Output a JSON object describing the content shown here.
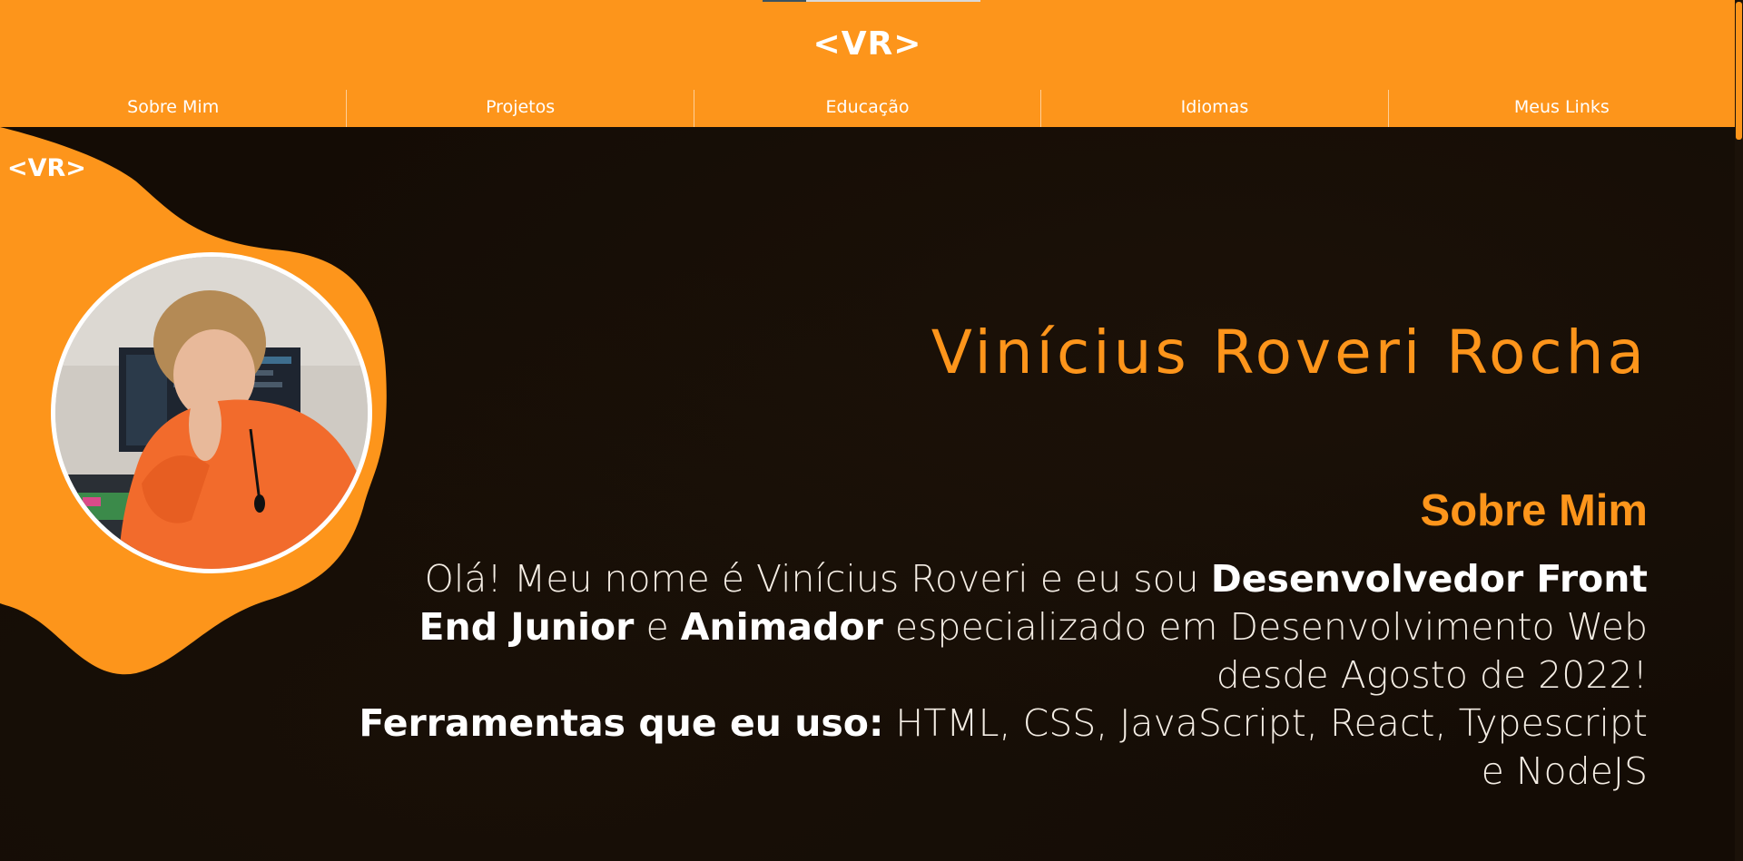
{
  "header": {
    "logo": "<VR>",
    "nav": [
      "Sobre Mim",
      "Projetos",
      "Educação",
      "Idiomas",
      "Meus Links"
    ]
  },
  "hero": {
    "blob_logo": "<VR>",
    "avatar_alt": "avatar-photo",
    "name": "Vinícius Roveri Rocha",
    "section_title": "Sobre Mim",
    "about": {
      "p1_a": "Olá! Meu nome é Vinícius Roveri e eu sou ",
      "p1_b": "Desenvolvedor Front End Junior",
      "p1_c": " e ",
      "p1_d": "Animador",
      "p1_e": " especializado em Desenvolvimento Web desde Agosto de 2022!",
      "p2_a": "Ferramentas que eu uso:",
      "p2_b": " HTML, CSS, JavaScript, React, Typescript e NodeJS"
    }
  },
  "colors": {
    "accent": "#fd951b",
    "background": "#140c05",
    "text": "#f4ede4"
  }
}
